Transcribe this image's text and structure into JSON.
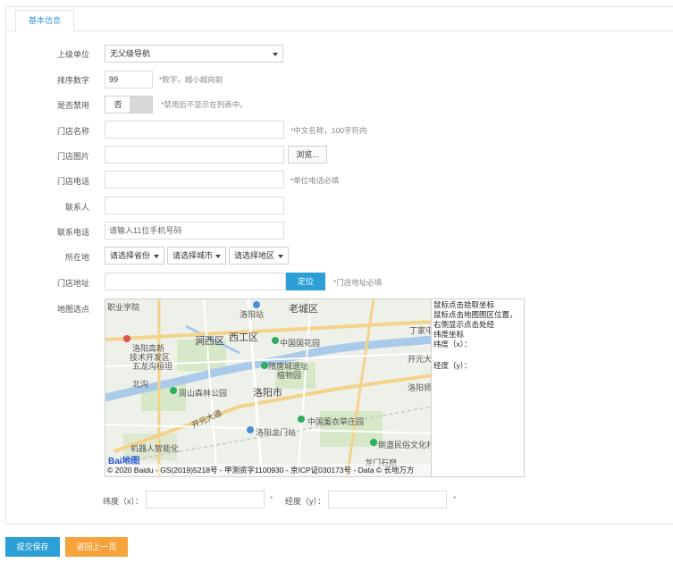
{
  "tab": {
    "label": "基本信息"
  },
  "form": {
    "parent": {
      "label": "上级单位",
      "value": "无父级导航"
    },
    "sort": {
      "label": "排序数字",
      "value": "99",
      "hint": "*数字，越小越向前"
    },
    "disabled": {
      "label": "是否禁用",
      "value": "否",
      "hint": "*禁用后不显示在列表中。"
    },
    "store_name": {
      "label": "门店名称",
      "value": "",
      "hint": "*中文名称，100字符内"
    },
    "store_image": {
      "label": "门店图片",
      "value": "",
      "browse_label": "浏览..."
    },
    "store_phone": {
      "label": "门店电话",
      "value": "",
      "hint": "*单位电话必填"
    },
    "contact": {
      "label": "联系人",
      "value": ""
    },
    "contact_phone": {
      "label": "联系电话",
      "placeholder": "请输入11位手机号码"
    },
    "location": {
      "label": "所在地",
      "province": "请选择省份",
      "city": "请选择城市",
      "district": "请选择地区"
    },
    "address": {
      "label": "门店地址",
      "value": "",
      "locate_label": "定位",
      "hint": "*门店地址必填"
    },
    "map_pick": {
      "label": "地图选点"
    }
  },
  "map": {
    "labels": {
      "l1": "职业学院",
      "l2": "洛阳站",
      "l3": "老城区",
      "l4": "洛阳高新",
      "l5": "技术开发区",
      "l6": "五龙沟桓坦",
      "l7": "涧西区",
      "l8": "西工区",
      "l9": "中国国花园",
      "l10": "隋唐城遗址",
      "l11": "植物园",
      "l12": "周山森林公园",
      "l13": "洛阳市",
      "l14": "开元大道",
      "l15": "洛阳龙门站",
      "l16": "中国薰衣草庄园",
      "l17": "机器人智能化",
      "l18": "倒盏民俗文化村",
      "l19": "开元大",
      "l20": "洛阳师",
      "l21": "丁家屯",
      "l22": "龙门石窟",
      "l23": "北沟"
    },
    "copyright": "© 2020 Baidu - GS(2019)5218号 - 甲测资字1100930 - 京ICP证030173号 - Data © 长地万方",
    "logo": "Bai地图"
  },
  "side_info": {
    "lines": [
      "鼠标点击拾取坐标",
      "鼠标点击地图图区位置，右侧显示点击处经",
      "纬度坐标",
      "纬度（x）：",
      "经度（y）："
    ]
  },
  "coords": {
    "lat_label": "纬度（x）：",
    "lat_value": "",
    "lat_star": "*",
    "lng_label": "经度（y）：",
    "lng_value": "",
    "lng_star": "*"
  },
  "footer": {
    "submit_label": "提交保存",
    "back_label": "返回上一页"
  },
  "colors": {
    "primary": "#2b9fd6",
    "orange": "#f7a33b",
    "tab_text": "#3a9bd8"
  }
}
